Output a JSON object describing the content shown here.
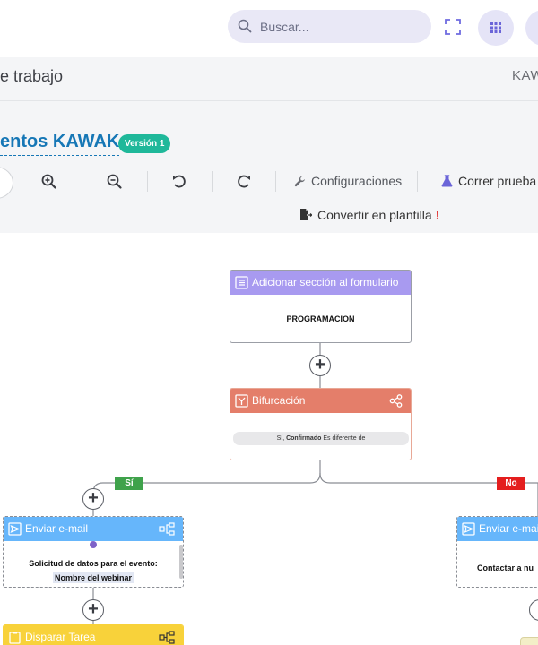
{
  "topbar": {
    "search_placeholder": "Buscar...",
    "search_icon": "search-icon",
    "expand_icon": "fullscreen-icon",
    "apps_icon": "apps-grid-icon"
  },
  "breadcrumb": {
    "title": "e trabajo",
    "right_label": "KAW"
  },
  "process": {
    "title": "entos KAWAK",
    "version_badge": "Versión 1"
  },
  "toolbar": {
    "zoom_in_icon": "zoom-in-icon",
    "zoom_out_icon": "zoom-out-icon",
    "undo_icon": "undo-icon",
    "redo_icon": "redo-icon",
    "settings_label": "Configuraciones",
    "test_label": "Correr prueba",
    "convert_label": "Convertir en plantilla",
    "convert_warning": "!"
  },
  "flow": {
    "node_form": {
      "title": "Adicionar sección al formulario",
      "body": "PROGRAMACION",
      "color": "#a89af0"
    },
    "node_fork": {
      "title": "Bifurcación",
      "condition_prefix": "Sí,",
      "condition_field": "Confirmado",
      "condition_rest": "Es diferente de",
      "color": "#e47e6a"
    },
    "branch_yes": {
      "label": "Sí",
      "color": "#3fa24b"
    },
    "branch_no": {
      "label": "No",
      "color": "#e41e1e"
    },
    "node_email_yes": {
      "title": "Enviar e-mail",
      "body_line1": "Solicitud de datos para el evento:",
      "body_line2": "Nombre del webinar",
      "color": "#66b6fb"
    },
    "node_email_no": {
      "title": "Enviar e-mail",
      "body": "Contactar a nu",
      "color": "#66b6fb"
    },
    "node_task": {
      "title": "Disparar Tarea",
      "color": "#f8d23a"
    }
  }
}
